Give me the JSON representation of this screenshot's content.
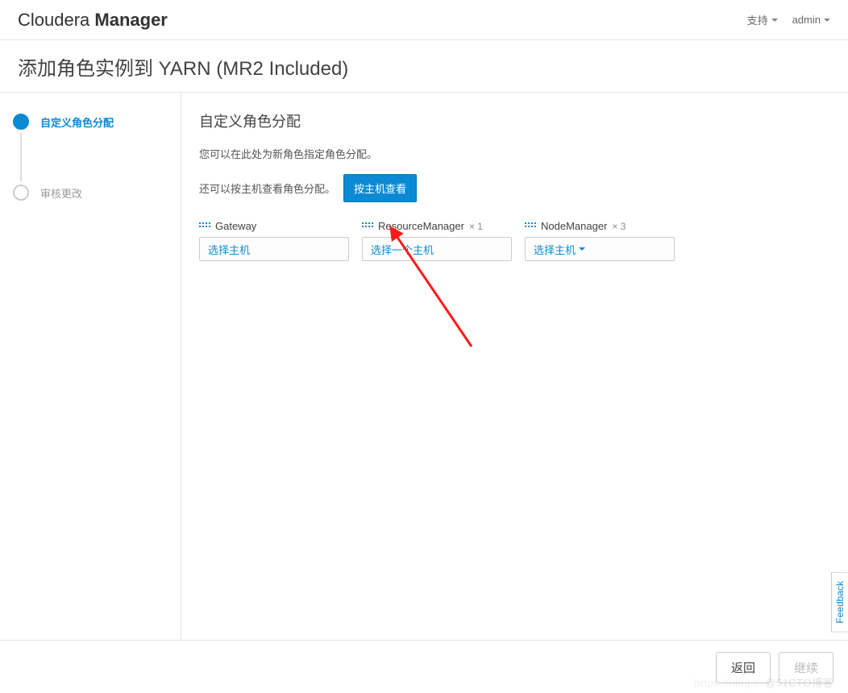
{
  "header": {
    "brand_light": "Cloudera ",
    "brand_heavy": "Manager",
    "support_label": "支持",
    "user_label": "admin"
  },
  "page_title": "添加角色实例到 YARN (MR2 Included)",
  "steps": [
    {
      "label": "自定义角色分配",
      "active": true
    },
    {
      "label": "审核更改",
      "active": false
    }
  ],
  "content": {
    "section_title": "自定义角色分配",
    "desc1": "您可以在此处为新角色指定角色分配。",
    "desc2_prefix": "还可以按主机查看角色分配。",
    "view_by_host_btn": "按主机查看",
    "roles": [
      {
        "name": "Gateway",
        "count_suffix": "",
        "select_label": "选择主机",
        "has_caret": false
      },
      {
        "name": "ResourceManager",
        "count_suffix": " × 1",
        "select_label": "选择一个主机",
        "has_caret": false
      },
      {
        "name": "NodeManager",
        "count_suffix": " × 3",
        "select_label": "选择主机",
        "has_caret": true
      }
    ]
  },
  "footer": {
    "back": "返回",
    "continue": "继续"
  },
  "feedback_label": "Feedback",
  "watermark": {
    "faint": "https://blog.cs",
    "solid": "@51CTO博客"
  }
}
